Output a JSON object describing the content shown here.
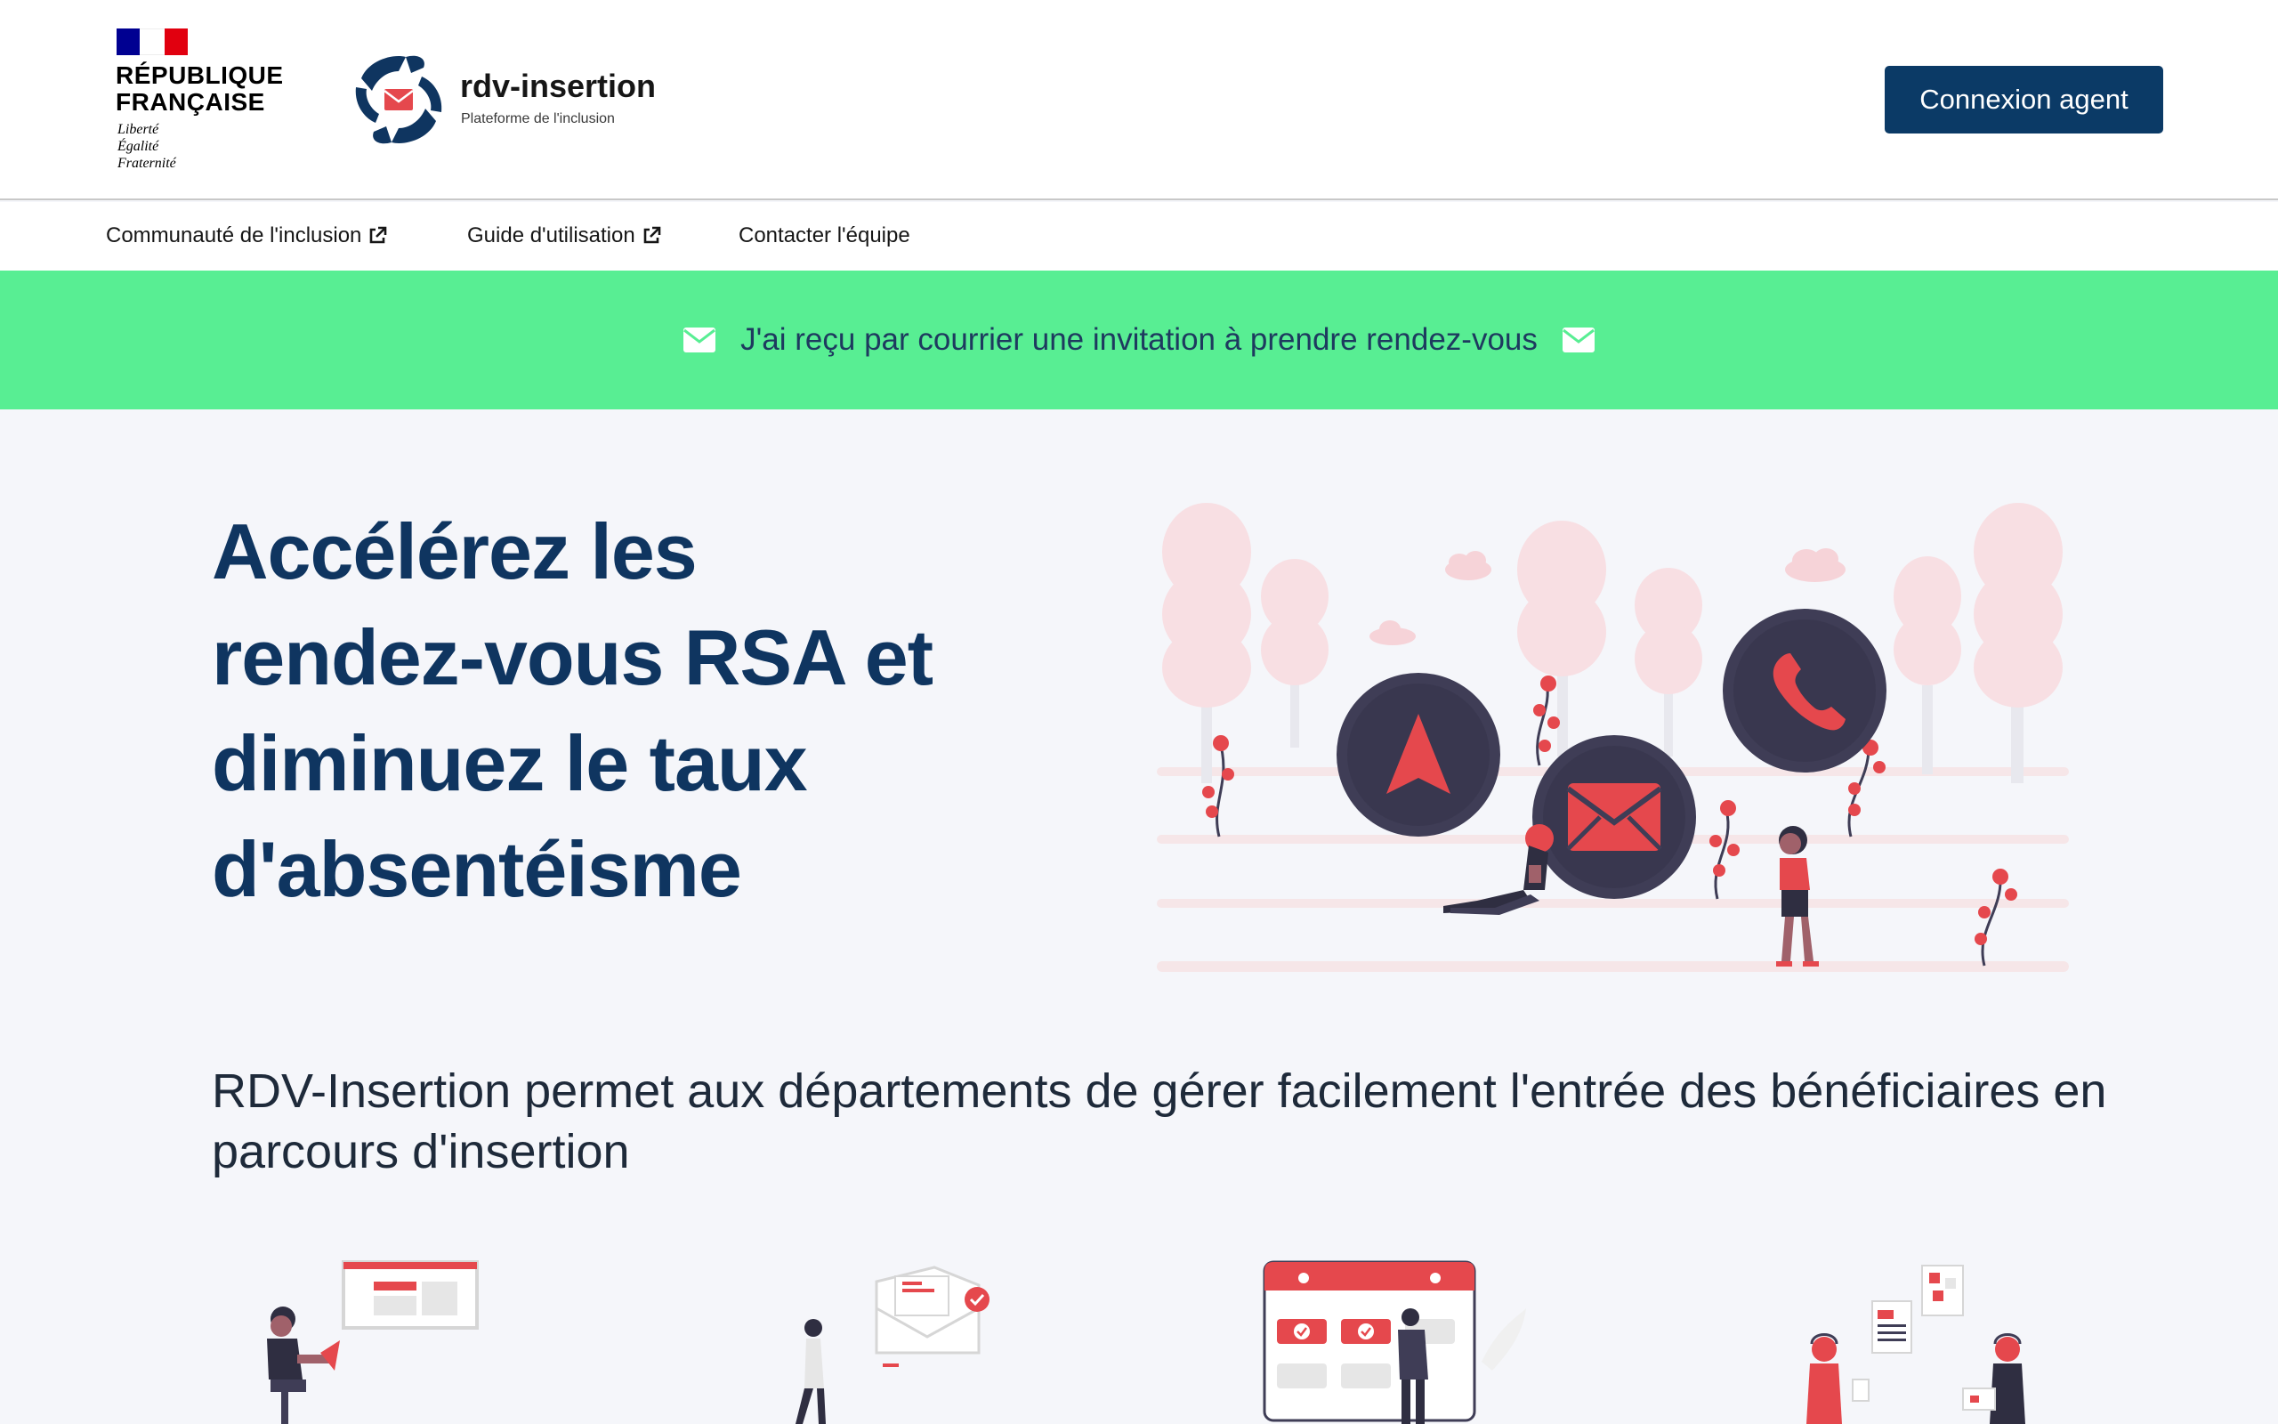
{
  "header": {
    "gov_name": "RÉPUBLIQUE FRANÇAISE",
    "gov_motto_1": "Liberté",
    "gov_motto_2": "Égalité",
    "gov_motto_3": "Fraternité",
    "brand_name": "rdv-insertion",
    "brand_subtitle": "Plateforme de l'inclusion",
    "login_label": "Connexion agent"
  },
  "nav": {
    "items": [
      {
        "label": "Communauté de l'inclusion",
        "external": true
      },
      {
        "label": "Guide d'utilisation",
        "external": true
      },
      {
        "label": "Contacter l'équipe",
        "external": false
      }
    ]
  },
  "banner": {
    "label": "J'ai reçu par courrier une invitation à prendre rendez-vous"
  },
  "hero": {
    "title_line_1": "Accélérez les",
    "title_line_2": "rendez-vous RSA et",
    "title_line_3": "diminuez le taux",
    "title_line_4": "d'absentéisme"
  },
  "intro": {
    "text": "RDV-Insertion permet aux départements de gérer facilement l'entrée des bénéficiaires en parcours d'insertion"
  },
  "colors": {
    "primary": "#0b3a66",
    "title": "#0f3560",
    "banner": "#58ee93",
    "accent_red": "#e5484d",
    "dark_circle": "#3f3d56"
  }
}
